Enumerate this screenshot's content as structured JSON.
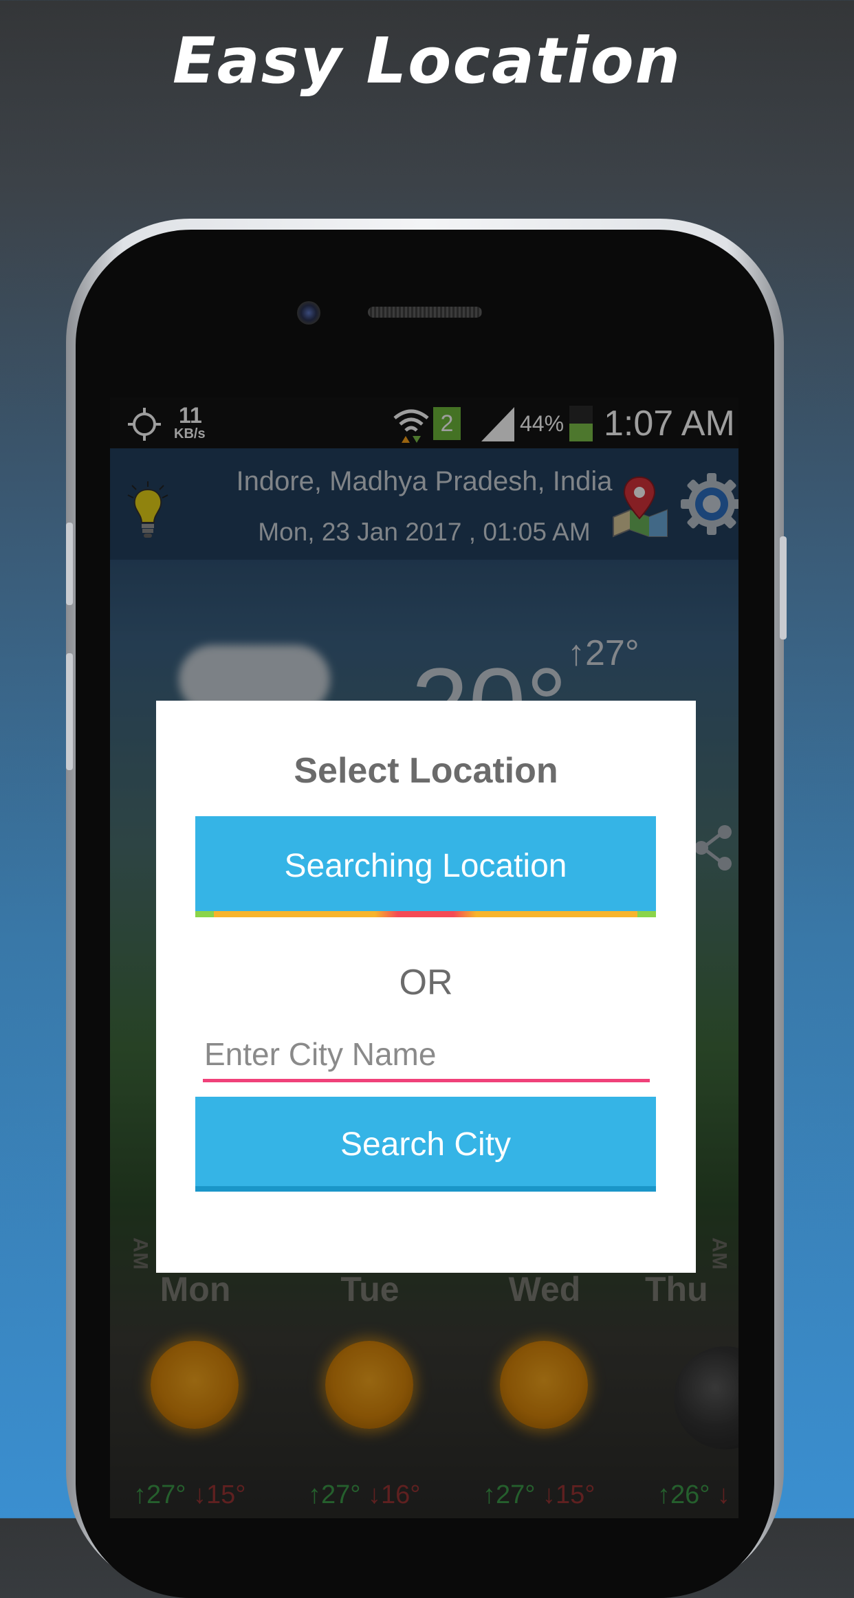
{
  "headline": "Easy Location",
  "status_bar": {
    "data_rate_value": "11",
    "data_rate_unit": "KB/s",
    "sim_badge": "2",
    "battery": "44%",
    "time": "1:07 AM"
  },
  "app_header": {
    "location": "Indore, Madhya Pradesh, India",
    "datetime": "Mon, 23 Jan 2017 , 01:05 AM"
  },
  "current_weather": {
    "temperature": "20°",
    "high": "↑27°"
  },
  "forecast": [
    {
      "day": "Mon",
      "high": "↑27°",
      "low": "↓15°",
      "icon": "sun-icon"
    },
    {
      "day": "Tue",
      "high": "↑27°",
      "low": "↓16°",
      "icon": "sun-icon"
    },
    {
      "day": "Wed",
      "high": "↑27°",
      "low": "↓15°",
      "icon": "sun-icon"
    },
    {
      "day": "Thu",
      "high": "↑26°",
      "low": "↓",
      "icon": "moon-icon"
    }
  ],
  "side_labels": {
    "left": "AM",
    "right": "AM"
  },
  "dialog": {
    "title": "Select Location",
    "search_location_label": "Searching Location",
    "or_label": "OR",
    "city_placeholder": "Enter City Name",
    "city_value": "",
    "search_city_label": "Search City"
  },
  "colors": {
    "button": "#35b4e6",
    "input_underline": "#f0417a",
    "forecast_high": "#3d9a4a",
    "forecast_low": "#9a3535"
  }
}
